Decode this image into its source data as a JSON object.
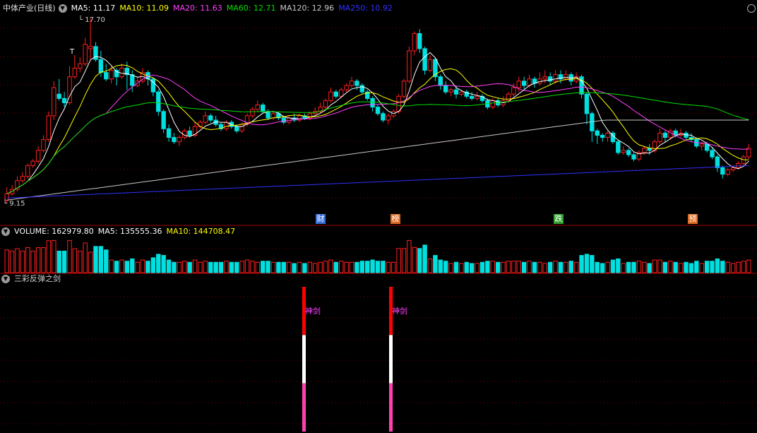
{
  "header": {
    "stock_name": "中体产业(日线)",
    "ma": [
      {
        "label": "MA5: 11.17",
        "color": "#ffffff"
      },
      {
        "label": "MA10: 11.09",
        "color": "#ffff00"
      },
      {
        "label": "MA20: 11.63",
        "color": "#ff40ff"
      },
      {
        "label": "MA60: 12.71",
        "color": "#00e000"
      },
      {
        "label": "MA120: 12.96",
        "color": "#c8c8c8"
      },
      {
        "label": "MA250: 10.92",
        "color": "#3030ff"
      }
    ]
  },
  "volume_header": {
    "items": [
      {
        "label": "VOLUME: 162979.80",
        "color": "#ffffff"
      },
      {
        "label": "MA5: 135555.36",
        "color": "#ffffff"
      },
      {
        "label": "MA10: 144708.47",
        "color": "#ffff00"
      }
    ]
  },
  "indicator_header": {
    "title": "三彩反弹之剑"
  },
  "annotations": {
    "high_label": "17.70",
    "low_label": "9.15",
    "high_t": "T",
    "jian_label": "神剑"
  },
  "event_markers": [
    {
      "text": "财",
      "color": "#3a6fd8"
    },
    {
      "text": "榜",
      "color": "#e06a20"
    },
    {
      "text": "跌",
      "color": "#30a030"
    },
    {
      "text": "预",
      "color": "#e06a20"
    }
  ],
  "colors": {
    "up": "#ff2020",
    "down": "#00e0e0",
    "ma5": "#ffffff",
    "ma10": "#ffff00",
    "ma20": "#ff40ff",
    "ma60": "#00e000",
    "ma120": "#c8c8c8",
    "ma250": "#3030ff",
    "grid": "#7a0000",
    "divider": "#a00000"
  },
  "chart_data": {
    "type": "candlestick",
    "panels": [
      "price",
      "volume",
      "三彩反弹之剑"
    ],
    "price_range": [
      9.15,
      17.7
    ],
    "ma_latest": {
      "MA5": 11.17,
      "MA10": 11.09,
      "MA20": 11.63,
      "MA60": 12.71,
      "MA120": 12.96,
      "MA250": 10.92
    },
    "volume_latest": {
      "VOLUME": 162979.8,
      "MA5": 135555.36,
      "MA10": 144708.47
    },
    "candles": [
      [
        9.3,
        9.6,
        9.9,
        9.15
      ],
      [
        9.6,
        9.8,
        10.0,
        9.5
      ],
      [
        9.8,
        10.2,
        10.4,
        9.7
      ],
      [
        10.2,
        10.4,
        10.6,
        10.1
      ],
      [
        10.4,
        10.9,
        11.0,
        10.3
      ],
      [
        10.9,
        11.1,
        11.2,
        10.8
      ],
      [
        11.1,
        11.6,
        11.8,
        11.0
      ],
      [
        11.6,
        12.1,
        12.3,
        11.5
      ],
      [
        12.1,
        13.2,
        13.4,
        12.0
      ],
      [
        13.2,
        14.5,
        14.8,
        13.0
      ],
      [
        14.2,
        14.0,
        14.9,
        13.9
      ],
      [
        14.0,
        13.8,
        14.3,
        13.6
      ],
      [
        13.8,
        15.0,
        15.5,
        13.7
      ],
      [
        15.0,
        15.4,
        16.0,
        14.9
      ],
      [
        15.4,
        15.6,
        15.9,
        15.2
      ],
      [
        15.6,
        16.5,
        16.8,
        15.5
      ],
      [
        16.3,
        16.4,
        17.7,
        15.8
      ],
      [
        16.4,
        15.8,
        16.6,
        15.7
      ],
      [
        15.8,
        15.2,
        16.2,
        15.0
      ],
      [
        15.2,
        14.9,
        15.6,
        14.8
      ],
      [
        14.9,
        15.3,
        15.5,
        14.7
      ],
      [
        15.3,
        15.0,
        15.4,
        14.6
      ],
      [
        15.0,
        15.4,
        15.6,
        14.9
      ],
      [
        15.4,
        15.1,
        15.7,
        14.4
      ],
      [
        15.1,
        14.6,
        15.3,
        14.3
      ],
      [
        14.6,
        14.8,
        15.0,
        14.5
      ],
      [
        14.8,
        15.2,
        15.4,
        14.7
      ],
      [
        15.2,
        14.9,
        15.3,
        14.6
      ],
      [
        14.9,
        14.3,
        15.0,
        14.1
      ],
      [
        14.3,
        13.4,
        14.4,
        13.2
      ],
      [
        13.4,
        12.6,
        13.5,
        12.4
      ],
      [
        12.6,
        12.2,
        12.8,
        12.0
      ],
      [
        12.2,
        12.0,
        12.4,
        11.9
      ],
      [
        12.0,
        12.2,
        12.3,
        11.8
      ],
      [
        12.2,
        12.5,
        12.6,
        12.1
      ],
      [
        12.5,
        12.3,
        12.7,
        12.2
      ],
      [
        12.3,
        12.7,
        12.9,
        12.2
      ],
      [
        12.7,
        12.9,
        13.0,
        12.6
      ],
      [
        12.9,
        13.2,
        13.4,
        12.8
      ],
      [
        13.2,
        13.0,
        13.3,
        12.9
      ],
      [
        13.0,
        12.8,
        13.2,
        12.7
      ],
      [
        12.8,
        12.6,
        12.9,
        12.5
      ],
      [
        12.6,
        12.9,
        13.0,
        12.5
      ],
      [
        12.9,
        12.7,
        13.0,
        12.6
      ],
      [
        12.7,
        12.5,
        12.8,
        12.4
      ],
      [
        12.5,
        12.8,
        12.9,
        12.4
      ],
      [
        12.8,
        13.2,
        13.3,
        12.7
      ],
      [
        13.2,
        13.5,
        13.6,
        13.1
      ],
      [
        13.5,
        13.7,
        13.9,
        13.4
      ],
      [
        13.7,
        13.4,
        13.8,
        13.3
      ],
      [
        13.4,
        13.1,
        13.5,
        13.0
      ],
      [
        13.1,
        13.3,
        13.4,
        13.0
      ],
      [
        13.3,
        13.1,
        13.4,
        13.0
      ],
      [
        13.1,
        12.9,
        13.2,
        12.8
      ],
      [
        12.9,
        13.1,
        13.2,
        12.8
      ],
      [
        13.1,
        13.0,
        13.3,
        12.9
      ],
      [
        13.0,
        13.2,
        13.3,
        12.9
      ],
      [
        13.2,
        13.1,
        13.3,
        13.0
      ],
      [
        13.1,
        13.3,
        13.4,
        13.0
      ],
      [
        13.3,
        13.4,
        13.6,
        13.2
      ],
      [
        13.4,
        13.6,
        13.8,
        13.3
      ],
      [
        13.6,
        13.9,
        14.0,
        13.5
      ],
      [
        13.9,
        14.3,
        14.5,
        13.8
      ],
      [
        14.3,
        14.1,
        14.4,
        14.0
      ],
      [
        14.1,
        14.4,
        14.5,
        14.0
      ],
      [
        14.4,
        14.6,
        14.7,
        14.3
      ],
      [
        14.6,
        14.8,
        15.0,
        14.5
      ],
      [
        14.8,
        14.6,
        14.9,
        14.4
      ],
      [
        14.6,
        14.3,
        14.7,
        14.2
      ],
      [
        14.3,
        14.0,
        14.4,
        13.9
      ],
      [
        14.0,
        13.6,
        14.1,
        13.4
      ],
      [
        13.6,
        13.3,
        13.7,
        13.2
      ],
      [
        13.3,
        13.0,
        13.4,
        12.9
      ],
      [
        13.0,
        13.2,
        13.3,
        12.8
      ],
      [
        13.2,
        13.4,
        13.5,
        13.1
      ],
      [
        13.4,
        14.1,
        14.2,
        13.3
      ],
      [
        14.1,
        14.8,
        14.9,
        14.0
      ],
      [
        14.8,
        16.2,
        16.4,
        14.7
      ],
      [
        16.2,
        17.0,
        17.1,
        16.0
      ],
      [
        17.0,
        16.3,
        17.2,
        16.1
      ],
      [
        16.3,
        15.3,
        16.4,
        15.1
      ],
      [
        15.3,
        15.8,
        16.0,
        15.2
      ],
      [
        15.8,
        15.0,
        15.9,
        14.8
      ],
      [
        15.0,
        14.6,
        15.1,
        14.4
      ],
      [
        14.6,
        14.3,
        14.8,
        14.2
      ],
      [
        14.3,
        14.4,
        14.5,
        14.1
      ],
      [
        14.4,
        14.2,
        14.6,
        14.0
      ],
      [
        14.2,
        14.3,
        14.4,
        14.1
      ],
      [
        14.3,
        14.1,
        14.4,
        14.0
      ],
      [
        14.1,
        14.0,
        14.3,
        13.9
      ],
      [
        14.0,
        14.1,
        14.3,
        13.9
      ],
      [
        14.1,
        13.9,
        14.2,
        13.8
      ],
      [
        13.9,
        13.6,
        14.0,
        13.5
      ],
      [
        13.6,
        13.9,
        14.0,
        13.5
      ],
      [
        13.9,
        13.7,
        14.0,
        13.6
      ],
      [
        13.7,
        13.9,
        14.1,
        13.6
      ],
      [
        13.9,
        14.2,
        14.3,
        13.8
      ],
      [
        14.2,
        14.5,
        14.7,
        14.1
      ],
      [
        14.5,
        14.8,
        15.0,
        14.3
      ],
      [
        14.8,
        14.6,
        15.0,
        14.4
      ],
      [
        14.6,
        14.9,
        15.1,
        14.5
      ],
      [
        14.9,
        14.7,
        15.0,
        14.5
      ],
      [
        14.7,
        14.9,
        15.2,
        14.6
      ],
      [
        14.9,
        15.0,
        15.3,
        14.7
      ],
      [
        15.0,
        14.8,
        15.2,
        14.6
      ],
      [
        14.8,
        15.1,
        15.3,
        14.7
      ],
      [
        15.1,
        14.9,
        15.3,
        14.7
      ],
      [
        14.9,
        15.1,
        15.3,
        14.8
      ],
      [
        15.1,
        14.8,
        15.2,
        14.6
      ],
      [
        14.8,
        15.0,
        15.2,
        14.7
      ],
      [
        15.0,
        14.2,
        15.1,
        14.0
      ],
      [
        14.2,
        13.3,
        14.3,
        12.8
      ],
      [
        13.3,
        12.5,
        13.4,
        12.0
      ],
      [
        12.5,
        12.3,
        12.6,
        11.9
      ],
      [
        12.3,
        12.2,
        12.4,
        12.0
      ],
      [
        12.2,
        12.4,
        12.5,
        12.0
      ],
      [
        12.4,
        12.0,
        12.5,
        11.9
      ],
      [
        12.0,
        11.5,
        12.1,
        11.4
      ],
      [
        11.5,
        11.6,
        11.8,
        11.4
      ],
      [
        11.6,
        11.4,
        11.7,
        11.3
      ],
      [
        11.4,
        11.2,
        11.5,
        11.1
      ],
      [
        11.2,
        11.5,
        11.6,
        11.1
      ],
      [
        11.5,
        11.7,
        11.8,
        11.4
      ],
      [
        11.7,
        11.6,
        11.9,
        11.4
      ],
      [
        11.6,
        12.0,
        12.1,
        11.5
      ],
      [
        12.0,
        12.4,
        12.6,
        11.9
      ],
      [
        12.4,
        12.2,
        12.5,
        12.0
      ],
      [
        12.2,
        12.5,
        12.6,
        12.1
      ],
      [
        12.5,
        12.3,
        12.6,
        12.2
      ],
      [
        12.3,
        12.4,
        12.6,
        12.2
      ],
      [
        12.4,
        12.2,
        12.5,
        12.1
      ],
      [
        12.2,
        12.1,
        12.4,
        12.0
      ],
      [
        12.1,
        11.8,
        12.2,
        11.7
      ],
      [
        11.8,
        11.9,
        12.0,
        11.6
      ],
      [
        11.9,
        11.6,
        12.0,
        11.5
      ],
      [
        11.6,
        11.3,
        11.7,
        11.2
      ],
      [
        11.3,
        10.8,
        11.4,
        10.6
      ],
      [
        10.8,
        10.5,
        10.9,
        10.3
      ],
      [
        10.5,
        10.7,
        10.8,
        10.4
      ],
      [
        10.7,
        10.8,
        10.9,
        10.6
      ],
      [
        10.8,
        11.0,
        11.1,
        10.7
      ],
      [
        11.0,
        11.3,
        11.4,
        10.9
      ],
      [
        11.3,
        11.7,
        11.9,
        11.2
      ]
    ],
    "signals": [
      {
        "label": "神剑",
        "segments": [
          "#ff0000",
          "#ffffff",
          "#ff40b0"
        ]
      },
      {
        "label": "神剑",
        "segments": [
          "#ff0000",
          "#ffffff",
          "#ff40b0"
        ]
      }
    ]
  }
}
